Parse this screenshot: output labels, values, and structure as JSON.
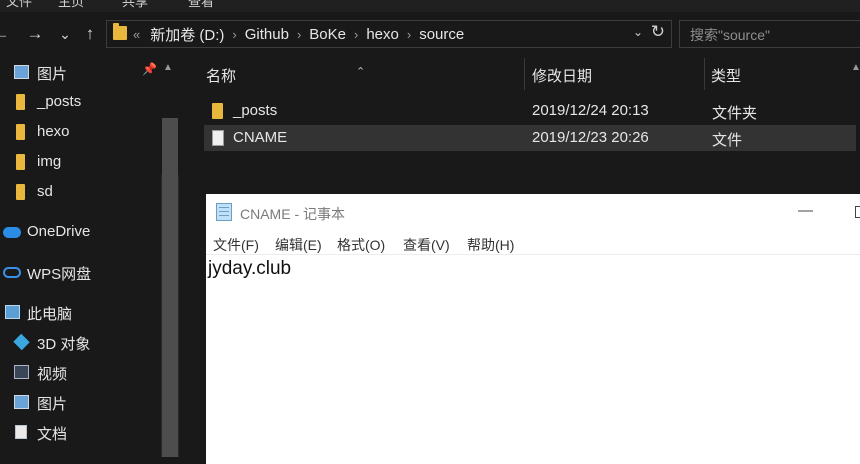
{
  "ribbon": {
    "items": [
      "文件",
      "主页",
      "共享",
      "查看"
    ]
  },
  "nav": {
    "back": "←",
    "forward": "→",
    "recent": "⌄",
    "up": "↑"
  },
  "address": {
    "overflow": "«",
    "crumbs": [
      "新加卷 (D:)",
      "Github",
      "BoKe",
      "hexo",
      "source"
    ],
    "separator": "›",
    "dropdown": "⌄",
    "refresh": "↻"
  },
  "search": {
    "placeholder": "搜索\"source\""
  },
  "sidebar": {
    "items": [
      {
        "label": "图片",
        "icon": "pictures-icon"
      },
      {
        "label": "_posts",
        "icon": "folder-icon"
      },
      {
        "label": "hexo",
        "icon": "folder-icon"
      },
      {
        "label": "img",
        "icon": "folder-icon"
      },
      {
        "label": "sd",
        "icon": "folder-icon"
      },
      {
        "label": "OneDrive",
        "icon": "onedrive-icon"
      },
      {
        "label": "WPS网盘",
        "icon": "wps-cloud-icon"
      },
      {
        "label": "此电脑",
        "icon": "this-pc-icon"
      },
      {
        "label": "3D 对象",
        "icon": "3d-objects-icon"
      },
      {
        "label": "视频",
        "icon": "videos-icon"
      },
      {
        "label": "图片",
        "icon": "pictures-icon"
      },
      {
        "label": "文档",
        "icon": "documents-icon"
      }
    ]
  },
  "list": {
    "columns": {
      "name": "名称",
      "modified": "修改日期",
      "type": "类型"
    },
    "rows": [
      {
        "name": "_posts",
        "modified": "2019/12/24 20:13",
        "type": "文件夹",
        "icon": "folder-icon"
      },
      {
        "name": "CNAME",
        "modified": "2019/12/23 20:26",
        "type": "文件",
        "icon": "file-icon"
      }
    ]
  },
  "notepad": {
    "title": "CNAME - 记事本",
    "minimize": "—",
    "menu": [
      "文件(F)",
      "编辑(E)",
      "格式(O)",
      "查看(V)",
      "帮助(H)"
    ],
    "content": "jyday.club"
  },
  "colors": {
    "background": "#191919",
    "folder": "#e8b73b",
    "selected_row": "#333333",
    "notepad_bg": "#ffffff"
  }
}
